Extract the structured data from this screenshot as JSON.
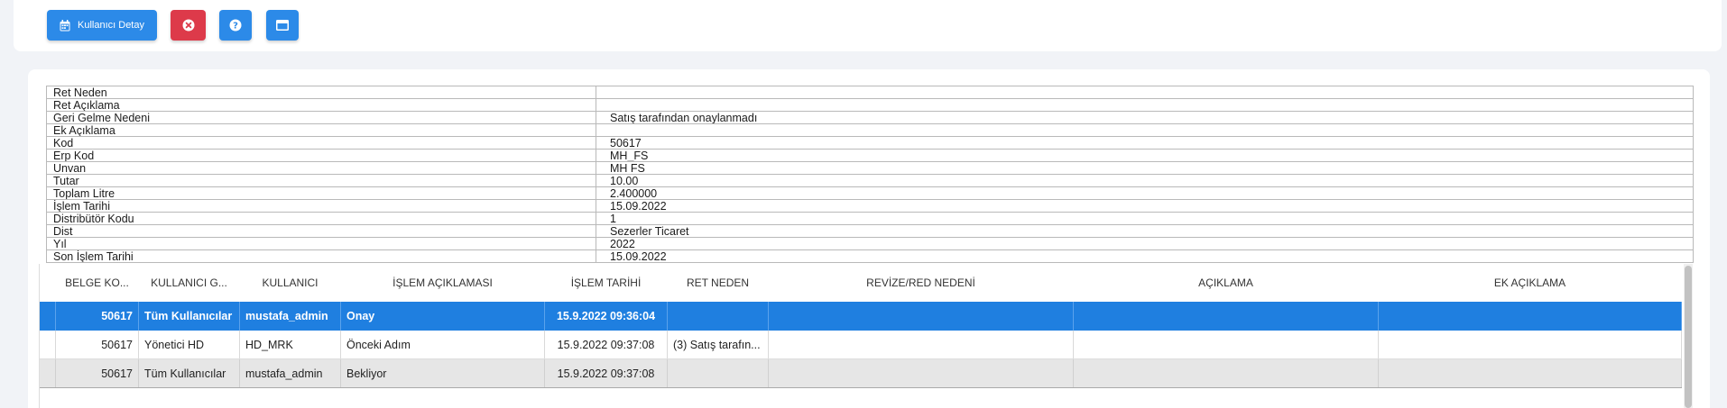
{
  "toolbar": {
    "detail_label": "Kullanıcı Detay",
    "icons": {
      "detail": "calendar-icon",
      "close": "close-circle-icon",
      "help": "question-circle-icon",
      "window": "window-icon"
    },
    "colors": {
      "primary": "#2c8ae8",
      "danger": "#dd3a4a"
    }
  },
  "details": [
    {
      "label": "Ret Neden",
      "value": ""
    },
    {
      "label": "Ret Açıklama",
      "value": ""
    },
    {
      "label": "Geri Gelme Nedeni",
      "value": "Satış tarafından onaylanmadı"
    },
    {
      "label": "Ek Açıklama",
      "value": ""
    },
    {
      "label": "Kod",
      "value": "50617"
    },
    {
      "label": "Erp Kod",
      "value": "MH_FS"
    },
    {
      "label": "Unvan",
      "value": "MH FS"
    },
    {
      "label": "Tutar",
      "value": "10.00"
    },
    {
      "label": "Toplam Litre",
      "value": "2.400000"
    },
    {
      "label": "İşlem Tarihi",
      "value": "15.09.2022"
    },
    {
      "label": "Distribütör Kodu",
      "value": "1"
    },
    {
      "label": "Dist",
      "value": "Sezerler Ticaret"
    },
    {
      "label": "Yıl",
      "value": "2022"
    },
    {
      "label": "Son İşlem Tarihi",
      "value": "15.09.2022"
    }
  ],
  "grid": {
    "headers": [
      "",
      "BELGE KO...",
      "KULLANICI G...",
      "KULLANICI",
      "İŞLEM AÇIKLAMASI",
      "İŞLEM TARİHİ",
      "RET NEDEN",
      "REVİZE/RED NEDENİ",
      "AÇIKLAMA",
      "EK AÇIKLAMA"
    ],
    "rows": [
      [
        "",
        "50617",
        "Tüm Kullanıcılar",
        "mustafa_admin",
        "Onay",
        "15.9.2022 09:36:04",
        "",
        "",
        "",
        ""
      ],
      [
        "",
        "50617",
        "Yönetici HD",
        "HD_MRK",
        "Önceki Adım",
        "15.9.2022 09:37:08",
        "(3) Satış tarafın...",
        "",
        "",
        ""
      ],
      [
        "",
        "50617",
        "Tüm Kullanıcılar",
        "mustafa_admin",
        "Bekliyor",
        "15.9.2022 09:37:08",
        "",
        "",
        "",
        ""
      ]
    ],
    "selected_row_color": "#1f7fe0"
  }
}
